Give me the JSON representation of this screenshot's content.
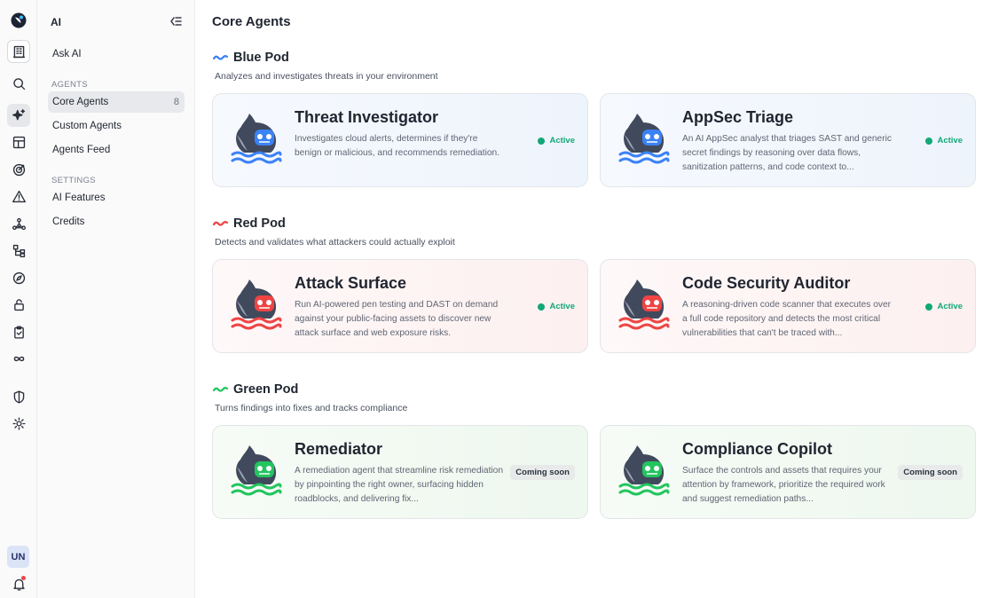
{
  "sidebar": {
    "title": "AI",
    "ask_ai": "Ask AI",
    "agents_section": "AGENTS",
    "core_agents": "Core Agents",
    "core_agents_count": "8",
    "custom_agents": "Custom Agents",
    "agents_feed": "Agents Feed",
    "settings_section": "SETTINGS",
    "ai_features": "AI Features",
    "credits": "Credits"
  },
  "rail": {
    "avatar_initials": "UN",
    "icons": [
      "logo-icon",
      "building-icon",
      "search-icon",
      "sparkles-icon",
      "layout-icon",
      "target-icon",
      "warning-icon",
      "network-icon",
      "hierarchy-icon",
      "compass-icon",
      "lock-icon",
      "clipboard-icon",
      "infinity-icon",
      "shield-icon",
      "gear-icon",
      "bell-icon"
    ]
  },
  "main": {
    "title": "Core Agents",
    "pods": [
      {
        "name": "Blue Pod",
        "description": "Analyzes and investigates threats in your environment",
        "color": "#3b82f6",
        "agents": [
          {
            "title": "Threat Investigator",
            "description": "Investigates cloud alerts, determines if they're benign or malicious, and recommends remediation.",
            "status": "Active"
          },
          {
            "title": "AppSec Triage",
            "description": "An AI AppSec analyst that triages SAST and generic secret findings by reasoning over data flows, sanitization patterns, and code context to...",
            "status": "Active"
          }
        ]
      },
      {
        "name": "Red Pod",
        "description": "Detects and validates what attackers could actually exploit",
        "color": "#ef4444",
        "agents": [
          {
            "title": "Attack Surface",
            "description": "Run AI-powered pen testing and DAST on demand against your public-facing assets to discover new attack surface and web exposure risks.",
            "status": "Active"
          },
          {
            "title": "Code Security Auditor",
            "description": "A reasoning-driven code scanner that executes over a full code repository and detects the most critical vulnerabilities that can't be traced with...",
            "status": "Active"
          }
        ]
      },
      {
        "name": "Green Pod",
        "description": "Turns findings into fixes and tracks compliance",
        "color": "#22c55e",
        "agents": [
          {
            "title": "Remediator",
            "description": "A remediation agent that streamline risk remediation by pinpointing the right owner, surfacing hidden roadblocks, and delivering fix...",
            "status": "Coming soon"
          },
          {
            "title": "Compliance Copilot",
            "description": "Surface the controls and assets that requires your attention by framework, prioritize the required work and suggest remediation paths...",
            "status": "Coming soon"
          }
        ]
      }
    ]
  },
  "colors": {
    "active_status": "#12a877",
    "mascot_body": "#414a5c"
  }
}
